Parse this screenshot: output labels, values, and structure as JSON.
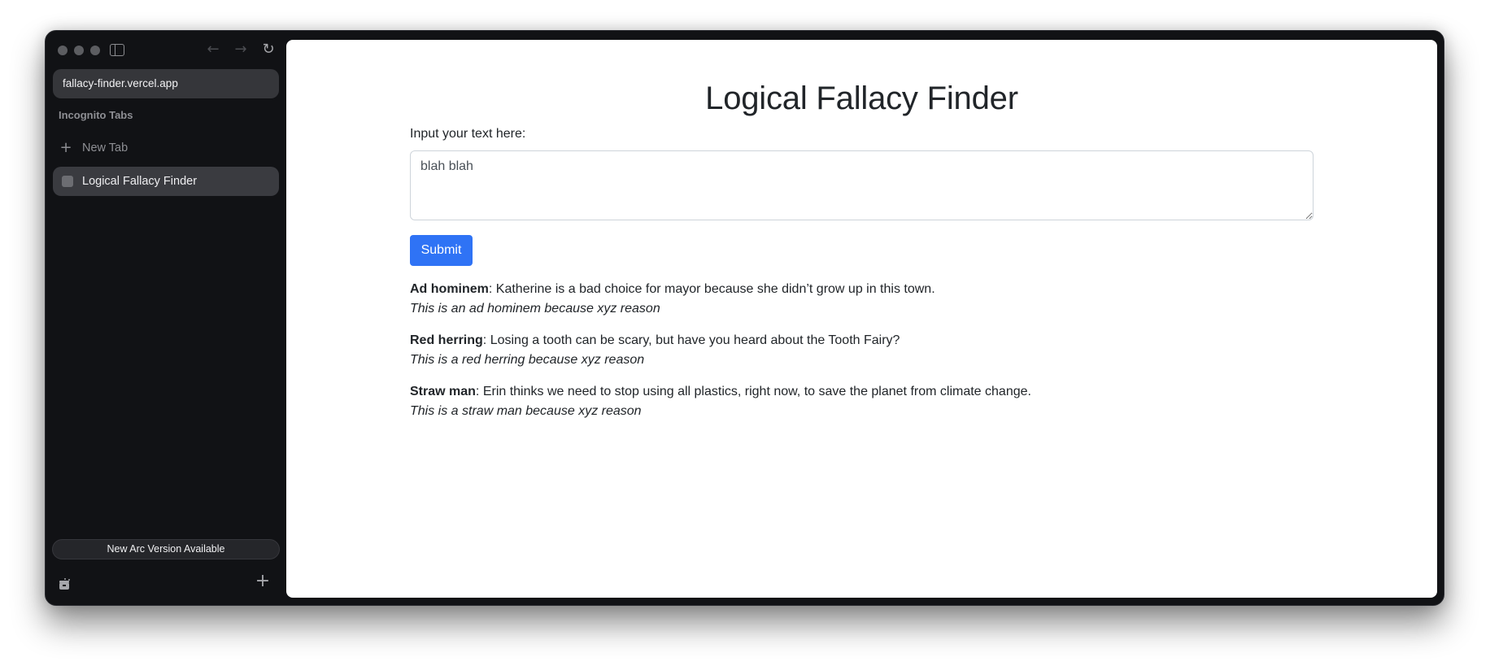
{
  "browser": {
    "url": "fallacy-finder.vercel.app",
    "section_label": "Incognito Tabs",
    "new_tab_label": "New Tab",
    "tabs": [
      {
        "label": "Logical Fallacy Finder",
        "active": true
      }
    ],
    "update_banner": "New Arc Version Available",
    "icons": {
      "traffic_lights": [
        "close-dot",
        "minimize-dot",
        "zoom-dot"
      ],
      "sidebar_toggle": "sidebar-toggle-icon",
      "back": "←",
      "forward": "→",
      "reload": "↻",
      "new_tab_plus": "+",
      "add": "+"
    }
  },
  "page": {
    "title": "Logical Fallacy Finder",
    "input_label": "Input your text here:",
    "input_value": "blah blah",
    "submit_label": "Submit",
    "submit_color": "#2f73f5",
    "results": [
      {
        "name": "Ad hominem",
        "example": ": Katherine is a bad choice for mayor because she didn’t grow up in this town.",
        "reason": "This is an ad hominem because xyz reason"
      },
      {
        "name": "Red herring",
        "example": ": Losing a tooth can be scary, but have you heard about the Tooth Fairy?",
        "reason": "This is a red herring because xyz reason"
      },
      {
        "name": "Straw man",
        "example": ": Erin thinks we need to stop using all plastics, right now, to save the planet from climate change.",
        "reason": "This is a straw man because xyz reason"
      }
    ]
  }
}
